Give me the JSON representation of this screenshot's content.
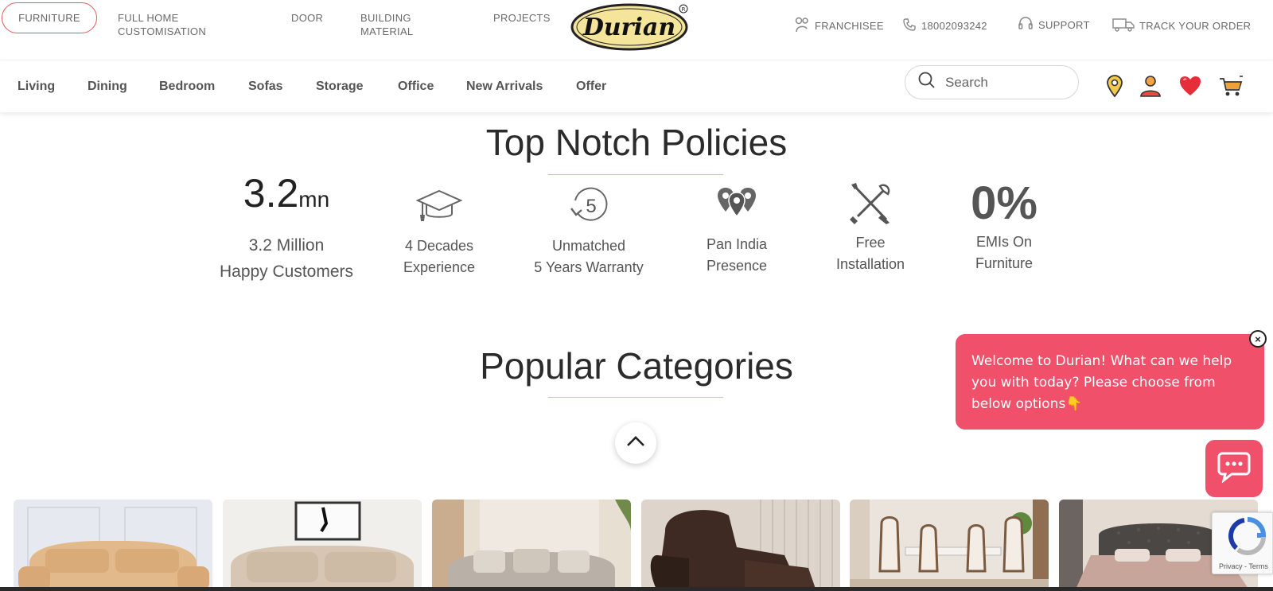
{
  "topbar": {
    "furniture": "FURNITURE",
    "full_home_1": "FULL HOME",
    "full_home_2": "CUSTOMISATION",
    "door": "DOOR",
    "building_1": "BUILDING",
    "building_2": "MATERIAL",
    "projects": "PROJECTS",
    "logo_text": "Durian",
    "franchisee": "FRANCHISEE",
    "phone": "18002093242",
    "support": "SUPPORT",
    "track": "TRACK YOUR ORDER"
  },
  "nav": {
    "items": [
      "Living",
      "Dining",
      "Bedroom",
      "Sofas",
      "Storage",
      "Office",
      "New Arrivals",
      "Offer"
    ],
    "search_placeholder": "Search"
  },
  "policies": {
    "title": "Top Notch Policies",
    "customers_number": "3.2",
    "customers_unit": "mn",
    "customers_line1": "3.2 Million",
    "customers_line2": "Happy Customers",
    "decades_line1": "4 Decades",
    "decades_line2": "Experience",
    "warranty_icon_number": "5",
    "warranty_line1": "Unmatched",
    "warranty_line2": "5 Years Warranty",
    "presence_line1": "Pan India",
    "presence_line2": "Presence",
    "install_line1": "Free",
    "install_line2": "Installation",
    "emi_big": "0%",
    "emi_line1": "EMIs On",
    "emi_line2": "Furniture"
  },
  "categories": {
    "title": "Popular Categories"
  },
  "chat": {
    "message": "Welcome to Durian! What can we help you with today? Please choose from below options👇",
    "close": "×"
  },
  "recaptcha": {
    "text": "Privacy - Terms"
  },
  "colors": {
    "accent": "#f0506a",
    "underline": "#e8c36a",
    "pill_border": "#e05a5a"
  }
}
